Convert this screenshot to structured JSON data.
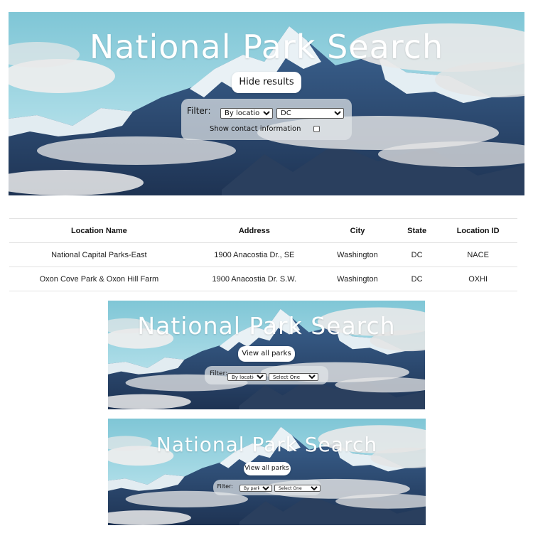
{
  "main": {
    "title": "National Park Search",
    "toggle_button": "Hide results",
    "filter_label": "Filter:",
    "filter_by_selected": "By location:",
    "filter_value_selected": "DC",
    "contact_label": "Show contact information",
    "contact_checked": false
  },
  "table": {
    "headers": [
      "Location Name",
      "Address",
      "City",
      "State",
      "Location ID"
    ],
    "rows": [
      [
        "National Capital Parks-East",
        "1900 Anacostia Dr., SE",
        "Washington",
        "DC",
        "NACE"
      ],
      [
        "Oxon Cove Park & Oxon Hill Farm",
        "1900 Anacostia Dr. S.W.",
        "Washington",
        "DC",
        "OXHI"
      ]
    ]
  },
  "preview_location": {
    "title": "National Park Search",
    "button": "View all parks",
    "filter_label": "Filter:",
    "filter_by_selected": "By location:",
    "filter_value_selected": "Select One"
  },
  "preview_park_type": {
    "title": "National Park Search",
    "button": "View all parks",
    "filter_label": "Filter:",
    "filter_by_selected": "By park type",
    "filter_value_selected": "Select One"
  },
  "colors": {
    "sky": "#8ccfdc",
    "mountain_dark": "#2c4a72",
    "snow": "#e8f0f4",
    "cloud": "#eeeeee"
  }
}
